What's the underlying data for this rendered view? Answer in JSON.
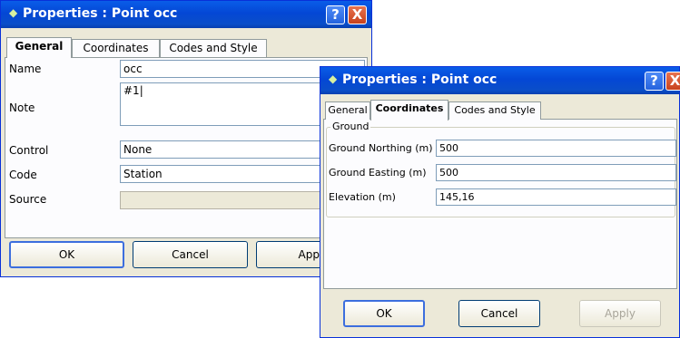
{
  "window1": {
    "title": "Properties : Point occ",
    "help_glyph": "?",
    "close_glyph": "X",
    "tabs": [
      {
        "label": "General",
        "active": true
      },
      {
        "label": "Coordinates",
        "active": false
      },
      {
        "label": "Codes and Style",
        "active": false
      }
    ],
    "fields": {
      "name": {
        "label": "Name",
        "value": "occ"
      },
      "note": {
        "label": "Note",
        "value": "#1|"
      },
      "control": {
        "label": "Control",
        "value": "None"
      },
      "code": {
        "label": "Code",
        "value": "Station"
      },
      "source": {
        "label": "Source",
        "value": ""
      }
    },
    "buttons": {
      "ok": "OK",
      "cancel": "Cancel",
      "apply": "Apply"
    }
  },
  "window2": {
    "title": "Properties : Point occ",
    "help_glyph": "?",
    "close_glyph": "X",
    "tabs": [
      {
        "label": "General",
        "active": false
      },
      {
        "label": "Coordinates",
        "active": true
      },
      {
        "label": "Codes and Style",
        "active": false
      }
    ],
    "group_label": "Ground",
    "fields": {
      "northing": {
        "label": "Ground Northing (m)",
        "value": "500"
      },
      "easting": {
        "label": "Ground Easting (m)",
        "value": "500"
      },
      "elevation": {
        "label": "Elevation (m)",
        "value": "145,16"
      }
    },
    "buttons": {
      "ok": "OK",
      "cancel": "Cancel",
      "apply": "Apply"
    }
  },
  "colors": {
    "titlebar": "#0447d5",
    "dialog_bg": "#ece9d8",
    "panel_bg": "#fcfcfe",
    "close_button": "#c8421c"
  },
  "icons": {
    "title_icon": "diamond-icon",
    "help": "help-icon",
    "close": "close-icon"
  }
}
